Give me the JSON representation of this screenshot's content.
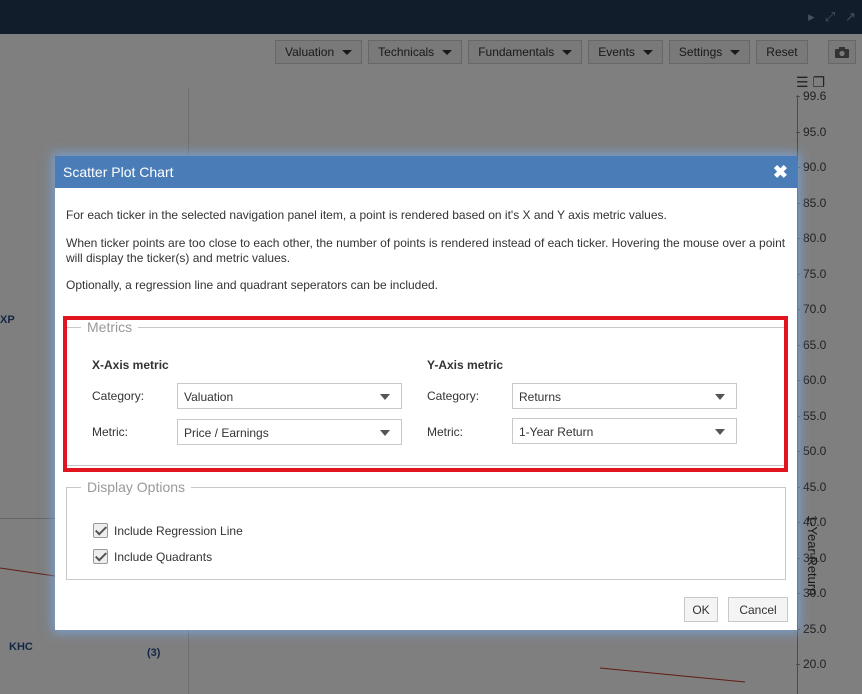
{
  "toolbar": {
    "valuation": "Valuation",
    "technicals": "Technicals",
    "fundamentals": "Fundamentals",
    "events": "Events",
    "settings": "Settings",
    "reset": "Reset"
  },
  "chart": {
    "y_ticks": [
      "99.6",
      "95.0",
      "90.0",
      "85.0",
      "80.0",
      "75.0",
      "70.0",
      "65.0",
      "60.0",
      "55.0",
      "50.0",
      "45.0",
      "40.0",
      "35.0",
      "30.0",
      "25.0",
      "20.0"
    ],
    "y_label": "1-Year Return",
    "labels": {
      "xp": "XP",
      "khc": "KHC",
      "count": "(3)"
    }
  },
  "dialog": {
    "title": "Scatter Plot Chart",
    "paragraphs": [
      "For each ticker in the selected navigation panel item, a point is rendered based on it's X and Y axis metric values.",
      "When ticker points are too close to each other, the number of points is rendered instead of each ticker. Hovering the mouse over a point will display the ticker(s) and metric values.",
      "Optionally, a regression line and quadrant seperators can be included."
    ],
    "metrics": {
      "legend": "Metrics",
      "x_axis": {
        "heading": "X-Axis metric",
        "category_label": "Category:",
        "category_value": "Valuation",
        "metric_label": "Metric:",
        "metric_value": "Price / Earnings"
      },
      "y_axis": {
        "heading": "Y-Axis metric",
        "category_label": "Category:",
        "category_value": "Returns",
        "metric_label": "Metric:",
        "metric_value": "1-Year Return"
      }
    },
    "display_options": {
      "legend": "Display Options",
      "regression": {
        "label": "Include Regression Line",
        "checked": true
      },
      "quadrants": {
        "label": "Include Quadrants",
        "checked": true
      }
    },
    "ok_label": "OK",
    "cancel_label": "Cancel"
  },
  "colors": {
    "header": "#4a7cb7",
    "highlight": "#e0151f",
    "topbar": "#243a57"
  }
}
